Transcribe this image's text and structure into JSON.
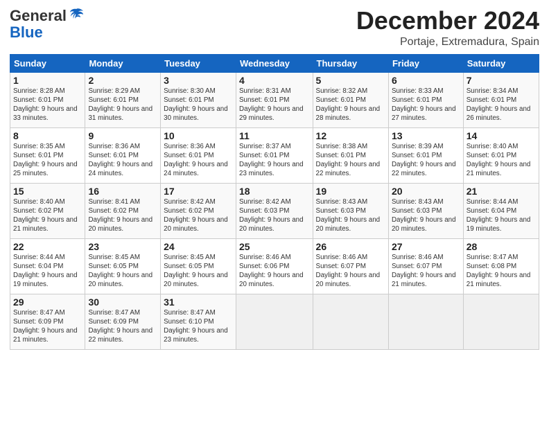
{
  "header": {
    "logo_general": "General",
    "logo_blue": "Blue",
    "month": "December 2024",
    "location": "Portaje, Extremadura, Spain"
  },
  "days_of_week": [
    "Sunday",
    "Monday",
    "Tuesday",
    "Wednesday",
    "Thursday",
    "Friday",
    "Saturday"
  ],
  "weeks": [
    [
      {
        "day": "1",
        "sunrise": "Sunrise: 8:28 AM",
        "sunset": "Sunset: 6:01 PM",
        "daylight": "Daylight: 9 hours and 33 minutes."
      },
      {
        "day": "2",
        "sunrise": "Sunrise: 8:29 AM",
        "sunset": "Sunset: 6:01 PM",
        "daylight": "Daylight: 9 hours and 31 minutes."
      },
      {
        "day": "3",
        "sunrise": "Sunrise: 8:30 AM",
        "sunset": "Sunset: 6:01 PM",
        "daylight": "Daylight: 9 hours and 30 minutes."
      },
      {
        "day": "4",
        "sunrise": "Sunrise: 8:31 AM",
        "sunset": "Sunset: 6:01 PM",
        "daylight": "Daylight: 9 hours and 29 minutes."
      },
      {
        "day": "5",
        "sunrise": "Sunrise: 8:32 AM",
        "sunset": "Sunset: 6:01 PM",
        "daylight": "Daylight: 9 hours and 28 minutes."
      },
      {
        "day": "6",
        "sunrise": "Sunrise: 8:33 AM",
        "sunset": "Sunset: 6:01 PM",
        "daylight": "Daylight: 9 hours and 27 minutes."
      },
      {
        "day": "7",
        "sunrise": "Sunrise: 8:34 AM",
        "sunset": "Sunset: 6:01 PM",
        "daylight": "Daylight: 9 hours and 26 minutes."
      }
    ],
    [
      {
        "day": "8",
        "sunrise": "Sunrise: 8:35 AM",
        "sunset": "Sunset: 6:01 PM",
        "daylight": "Daylight: 9 hours and 25 minutes."
      },
      {
        "day": "9",
        "sunrise": "Sunrise: 8:36 AM",
        "sunset": "Sunset: 6:01 PM",
        "daylight": "Daylight: 9 hours and 24 minutes."
      },
      {
        "day": "10",
        "sunrise": "Sunrise: 8:36 AM",
        "sunset": "Sunset: 6:01 PM",
        "daylight": "Daylight: 9 hours and 24 minutes."
      },
      {
        "day": "11",
        "sunrise": "Sunrise: 8:37 AM",
        "sunset": "Sunset: 6:01 PM",
        "daylight": "Daylight: 9 hours and 23 minutes."
      },
      {
        "day": "12",
        "sunrise": "Sunrise: 8:38 AM",
        "sunset": "Sunset: 6:01 PM",
        "daylight": "Daylight: 9 hours and 22 minutes."
      },
      {
        "day": "13",
        "sunrise": "Sunrise: 8:39 AM",
        "sunset": "Sunset: 6:01 PM",
        "daylight": "Daylight: 9 hours and 22 minutes."
      },
      {
        "day": "14",
        "sunrise": "Sunrise: 8:40 AM",
        "sunset": "Sunset: 6:01 PM",
        "daylight": "Daylight: 9 hours and 21 minutes."
      }
    ],
    [
      {
        "day": "15",
        "sunrise": "Sunrise: 8:40 AM",
        "sunset": "Sunset: 6:02 PM",
        "daylight": "Daylight: 9 hours and 21 minutes."
      },
      {
        "day": "16",
        "sunrise": "Sunrise: 8:41 AM",
        "sunset": "Sunset: 6:02 PM",
        "daylight": "Daylight: 9 hours and 20 minutes."
      },
      {
        "day": "17",
        "sunrise": "Sunrise: 8:42 AM",
        "sunset": "Sunset: 6:02 PM",
        "daylight": "Daylight: 9 hours and 20 minutes."
      },
      {
        "day": "18",
        "sunrise": "Sunrise: 8:42 AM",
        "sunset": "Sunset: 6:03 PM",
        "daylight": "Daylight: 9 hours and 20 minutes."
      },
      {
        "day": "19",
        "sunrise": "Sunrise: 8:43 AM",
        "sunset": "Sunset: 6:03 PM",
        "daylight": "Daylight: 9 hours and 20 minutes."
      },
      {
        "day": "20",
        "sunrise": "Sunrise: 8:43 AM",
        "sunset": "Sunset: 6:03 PM",
        "daylight": "Daylight: 9 hours and 20 minutes."
      },
      {
        "day": "21",
        "sunrise": "Sunrise: 8:44 AM",
        "sunset": "Sunset: 6:04 PM",
        "daylight": "Daylight: 9 hours and 19 minutes."
      }
    ],
    [
      {
        "day": "22",
        "sunrise": "Sunrise: 8:44 AM",
        "sunset": "Sunset: 6:04 PM",
        "daylight": "Daylight: 9 hours and 19 minutes."
      },
      {
        "day": "23",
        "sunrise": "Sunrise: 8:45 AM",
        "sunset": "Sunset: 6:05 PM",
        "daylight": "Daylight: 9 hours and 20 minutes."
      },
      {
        "day": "24",
        "sunrise": "Sunrise: 8:45 AM",
        "sunset": "Sunset: 6:05 PM",
        "daylight": "Daylight: 9 hours and 20 minutes."
      },
      {
        "day": "25",
        "sunrise": "Sunrise: 8:46 AM",
        "sunset": "Sunset: 6:06 PM",
        "daylight": "Daylight: 9 hours and 20 minutes."
      },
      {
        "day": "26",
        "sunrise": "Sunrise: 8:46 AM",
        "sunset": "Sunset: 6:07 PM",
        "daylight": "Daylight: 9 hours and 20 minutes."
      },
      {
        "day": "27",
        "sunrise": "Sunrise: 8:46 AM",
        "sunset": "Sunset: 6:07 PM",
        "daylight": "Daylight: 9 hours and 21 minutes."
      },
      {
        "day": "28",
        "sunrise": "Sunrise: 8:47 AM",
        "sunset": "Sunset: 6:08 PM",
        "daylight": "Daylight: 9 hours and 21 minutes."
      }
    ],
    [
      {
        "day": "29",
        "sunrise": "Sunrise: 8:47 AM",
        "sunset": "Sunset: 6:09 PM",
        "daylight": "Daylight: 9 hours and 21 minutes."
      },
      {
        "day": "30",
        "sunrise": "Sunrise: 8:47 AM",
        "sunset": "Sunset: 6:09 PM",
        "daylight": "Daylight: 9 hours and 22 minutes."
      },
      {
        "day": "31",
        "sunrise": "Sunrise: 8:47 AM",
        "sunset": "Sunset: 6:10 PM",
        "daylight": "Daylight: 9 hours and 23 minutes."
      },
      null,
      null,
      null,
      null
    ]
  ]
}
